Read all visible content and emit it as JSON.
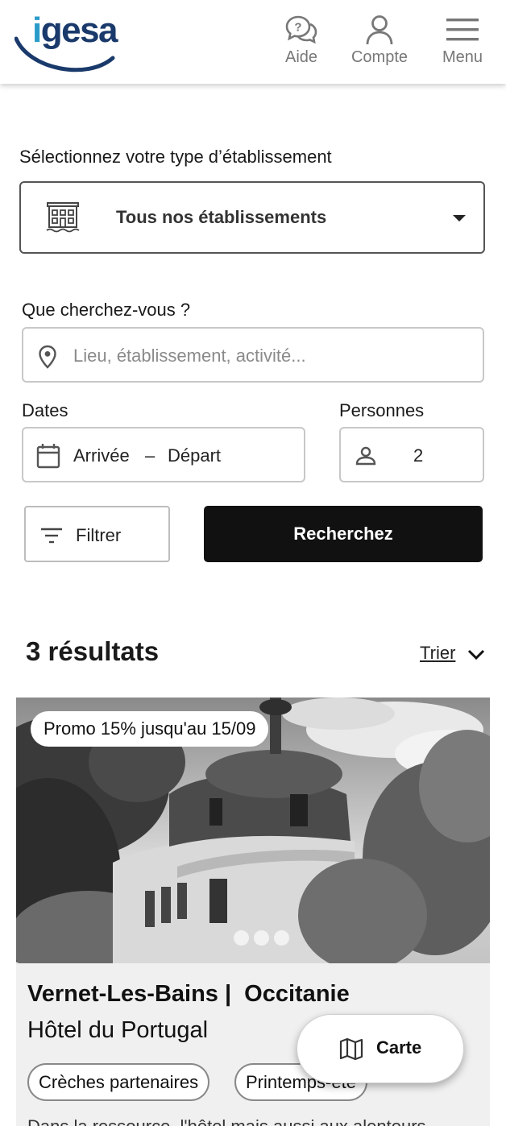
{
  "brand": {
    "logo_text_accent": "i",
    "logo_text_rest": "gesa"
  },
  "header": {
    "help_label": "Aide",
    "account_label": "Compte",
    "menu_label": "Menu"
  },
  "form": {
    "establishment_type_label": "Sélectionnez votre type d’établissement",
    "establishment_type_value": "Tous nos établissements",
    "search_label": "Que cherchez-vous ?",
    "search_placeholder": "Lieu, établissement, activité...",
    "dates_label": "Dates",
    "dates_arrival": "Arrivée",
    "dates_separator": "–",
    "dates_departure": "Départ",
    "persons_label": "Personnes",
    "persons_value": "2",
    "filter_label": "Filtrer",
    "search_button": "Recherchez"
  },
  "results": {
    "count_text": "3 résultats",
    "sort_label": "Trier"
  },
  "card": {
    "promo": "Promo 15% jusqu'au 15/09",
    "location_city": "Vernet-Les-Bains |",
    "location_region": "Occitanie",
    "name": "Hôtel du Portugal",
    "tags": [
      "Crèches partenaires",
      "Printemps-été"
    ],
    "description_peek": "Dans la ressource, l'hôtel mais aussi aux alentours..."
  },
  "map_button": {
    "label": "Carte"
  },
  "colors": {
    "brand_blue": "#1a3a6b",
    "brand_light": "#2b9cc9",
    "button_dark": "#111111"
  }
}
